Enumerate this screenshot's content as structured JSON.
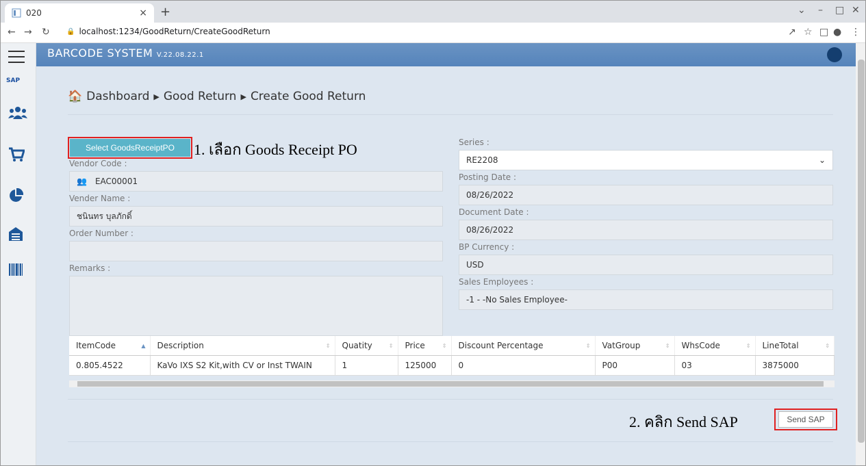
{
  "browser": {
    "tab_title": "020",
    "tab_close": "×",
    "new_tab": "+",
    "url": "localhost:1234/GoodReturn/CreateGoodReturn"
  },
  "app": {
    "brand": "BARCODE SYSTEM",
    "version": "V.22.08.22.1",
    "sap_label": "SAP"
  },
  "breadcrumb": {
    "home": "Dashboard",
    "level2": "Good Return",
    "level3": "Create Good Return"
  },
  "form": {
    "select_button": "Select GoodsReceiptPO",
    "vendor_code_label": "Vendor Code :",
    "vendor_code_value": "EAC00001",
    "vendor_name_label": "Vender Name :",
    "vendor_name_value": "ชนินทร บุลภักดิ์",
    "order_number_label": "Order Number :",
    "order_number_value": "",
    "remarks_label": "Remarks :",
    "series_label": "Series :",
    "series_value": "RE2208",
    "posting_date_label": "Posting Date :",
    "posting_date_value": "08/26/2022",
    "document_date_label": "Document Date :",
    "document_date_value": "08/26/2022",
    "bp_currency_label": "BP Currency :",
    "bp_currency_value": "USD",
    "sales_employees_label": "Sales Employees :",
    "sales_employees_value": "-1 - -No Sales Employee-"
  },
  "table": {
    "headers": [
      "ItemCode",
      "Description",
      "Quatity",
      "Price",
      "Discount Percentage",
      "VatGroup",
      "WhsCode",
      "LineTotal"
    ],
    "rows": [
      [
        "0.805.4522",
        "KaVo IXS S2 Kit,with CV or Inst TWAIN",
        "1",
        "125000",
        "0",
        "P00",
        "03",
        "3875000"
      ]
    ]
  },
  "annotations": {
    "step1": "1. เลือก Goods Receipt PO",
    "step2": "2. คลิก Send SAP"
  },
  "actions": {
    "send_sap": "Send SAP"
  },
  "colors": {
    "topbar": "#5584bb",
    "select_button": "#5ab4c9",
    "highlight": "#e02020"
  }
}
